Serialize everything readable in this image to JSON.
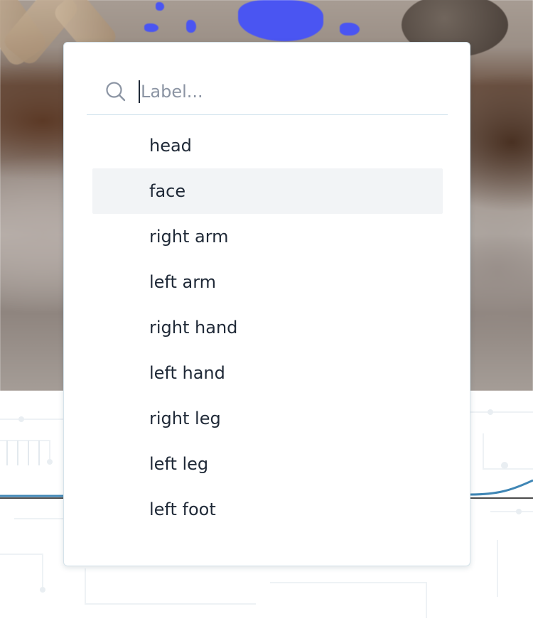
{
  "search": {
    "placeholder": "Label..."
  },
  "label_options": [
    {
      "label": "head",
      "highlighted": false
    },
    {
      "label": "face",
      "highlighted": true
    },
    {
      "label": "right arm",
      "highlighted": false
    },
    {
      "label": "left arm",
      "highlighted": false
    },
    {
      "label": "right hand",
      "highlighted": false
    },
    {
      "label": "left hand",
      "highlighted": false
    },
    {
      "label": "right leg",
      "highlighted": false
    },
    {
      "label": "left leg",
      "highlighted": false
    },
    {
      "label": "left foot",
      "highlighted": false
    }
  ],
  "colors": {
    "highlight_row": "#f2f4f6",
    "text": "#1f2937",
    "placeholder": "#8b94a3",
    "mask_blue": "#4a55f2",
    "curve_blue": "#3f86b5"
  },
  "icons": {
    "search": "search-icon"
  }
}
